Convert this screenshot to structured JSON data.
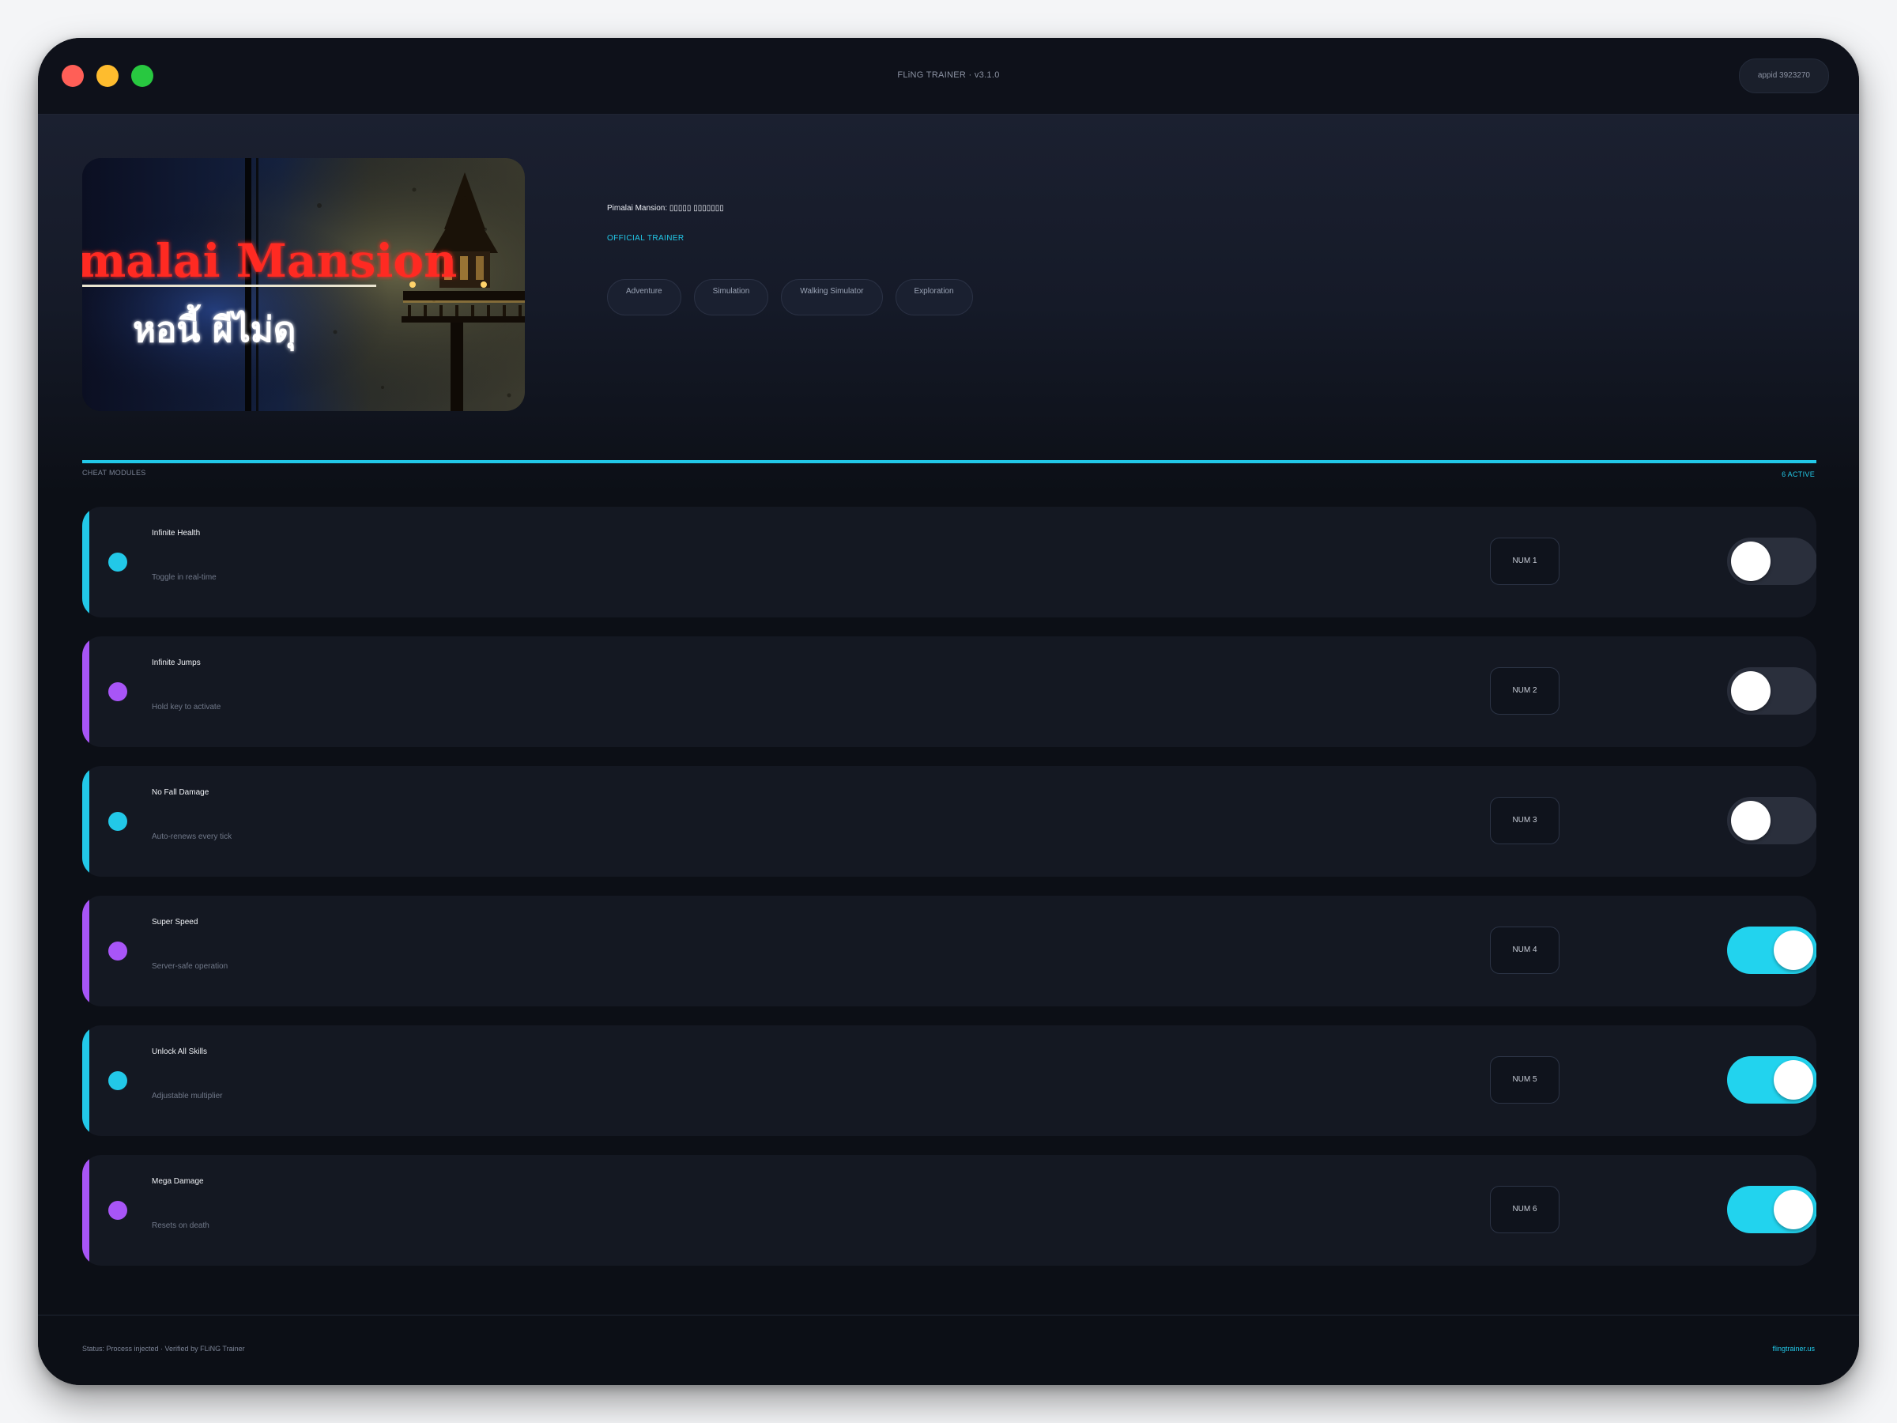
{
  "window": {
    "title": "FLiNG TRAINER · v3.1.0",
    "appid": "appid 3923270"
  },
  "game": {
    "title": "Pimalai Mansion: ▯▯▯▯▯ ▯▯▯▯▯▯▯",
    "badge": "OFFICIAL TRAINER",
    "cover": {
      "title_text": "malai Mansion",
      "subtitle_text": "หอนี้ ผีไม่ดุ"
    },
    "tags": [
      "Adventure",
      "Simulation",
      "Walking Simulator",
      "Exploration"
    ]
  },
  "section": {
    "label": "CHEAT MODULES",
    "active_count": "6 ACTIVE"
  },
  "cheats": [
    {
      "name": "Infinite Health",
      "desc": "Toggle in real-time",
      "hotkey": "NUM 1",
      "color": "#22c8e8",
      "on": false
    },
    {
      "name": "Infinite Jumps",
      "desc": "Hold key to activate",
      "hotkey": "NUM 2",
      "color": "#a855f7",
      "on": false
    },
    {
      "name": "No Fall Damage",
      "desc": "Auto-renews every tick",
      "hotkey": "NUM 3",
      "color": "#22c8e8",
      "on": false
    },
    {
      "name": "Super Speed",
      "desc": "Server-safe operation",
      "hotkey": "NUM 4",
      "color": "#a855f7",
      "on": true
    },
    {
      "name": "Unlock All Skills",
      "desc": "Adjustable multiplier",
      "hotkey": "NUM 5",
      "color": "#22c8e8",
      "on": true
    },
    {
      "name": "Mega Damage",
      "desc": "Resets on death",
      "hotkey": "NUM 6",
      "color": "#a855f7",
      "on": true
    }
  ],
  "footer": {
    "status": "Status: Process injected · Verified by FLiNG Trainer",
    "site": "flingtrainer.us"
  },
  "colors": {
    "accent_cyan": "#22c8e8",
    "accent_purple": "#a855f7",
    "toggle_on": "#22d3ee",
    "background": "#0c0f16"
  }
}
